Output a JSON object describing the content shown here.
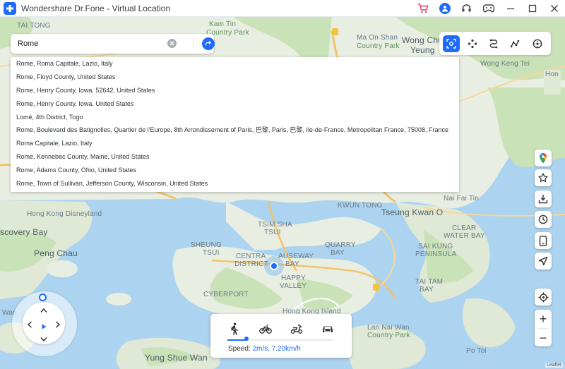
{
  "app": {
    "title": "Wondershare Dr.Fone - Virtual Location",
    "accent": "#1f6bff"
  },
  "titlebar_icons": [
    "cart-icon",
    "user-icon",
    "headset-icon",
    "gamepad-icon",
    "minimize-icon",
    "maximize-icon",
    "close-icon"
  ],
  "search": {
    "value": "Rome",
    "clear_icon": "clear-icon",
    "go_icon": "go-arrow-icon"
  },
  "results": [
    "Rome, Roma Capitale, Lazio, Italy",
    "Rome, Floyd County, United States",
    "Rome, Henry County, Iowa, 52642, United States",
    "Rome, Henry County, Iowa, United States",
    "Lomé, 4th District, Togo",
    "Rome, Boulevard des Batignolles, Quartier de l'Europe, 8th Arrondissement of Paris, 巴黎, Paris, 巴黎, Ile-de-France, Metropolitan France, 75008, France",
    "Roma Capitale, Lazio, Italy",
    "Rome, Kennebec County, Maine, United States",
    "Rome, Adams County, Ohio, United States",
    "Rome, Town of Sullivan, Jefferson County, Wisconsin, United States"
  ],
  "mode_toolbar": {
    "active_index": 0,
    "icons": [
      "teleport-mode-icon",
      "jump-teleport-icon",
      "one-stop-route-icon",
      "multi-stop-route-icon",
      "joystick-mode-icon"
    ]
  },
  "side_buttons": [
    "google-maps-icon",
    "favorites-icon",
    "import-gpx-icon",
    "history-icon",
    "device-icon",
    "navigate-icon"
  ],
  "zoom": {
    "locate_icon": "locate-icon",
    "plus": "+",
    "minus": "−"
  },
  "map_labels": {
    "tai_tong": "TAI TONG",
    "kam_tin": "Kam Tin",
    "country_park": "Country Park",
    "ma_on_shan": "Ma On Shan",
    "ma_on_shan_park": "Country Park",
    "wong_chuk_yeung_1": "Wong Chu",
    "wong_chuk_yeung_2": "Yeung",
    "wong_keng_tei": "Wong Keng Tei",
    "ping_chau": "Peng Chau",
    "discovery_bay": "scovery Bay",
    "hk_disneyland": "Hong Kong Disneyland",
    "tsim_sha_tsui_1": "TSIM SHA",
    "tsim_sha_tsui_2": "TSUI",
    "sheung_wan_1": "SHEUNG",
    "sheung_wan_2": "TSUI",
    "central_1": "CENTRA",
    "central_2": "DISTRICT",
    "causeway_1": "AUSEWAY",
    "causeway_2": "BAY",
    "quarry_1": "QUARRY",
    "quarry_2": "BAY",
    "happy_1": "HAPPY",
    "happy_2": "VALLEY",
    "cyberport": "CYBERPORT",
    "kwun_tong": "KWUN TONG",
    "tseung_kwan_o": "Tseung Kwan O",
    "clear_water_1": "CLEAR",
    "clear_water_2": "WATER BAY",
    "sai_kung_1": "SAI KUNG",
    "sai_kung_2": "PENINSULA",
    "tai_tam_1": "TAI TAM",
    "tai_tam_2": "BAY",
    "nai_fai_tin": "Nai Fai Tin",
    "hong_kong_island": "Hong Kong Island",
    "lan_nai_wan_1": "Lan Nai Wan",
    "lan_nai_wan_2": "Country Park",
    "yung_shue_wan": "Yung Shue Wan",
    "po_toi": "Po Toi",
    "south_lantau": "Wan",
    "big_wave": "Hon"
  },
  "speed": {
    "modes": [
      "walk-icon",
      "bike-icon",
      "scooter-icon",
      "car-icon"
    ],
    "active_index": 0,
    "level": 0.18,
    "label": "Speed:",
    "value": "2m/s, 7.20km/h"
  },
  "attribution": "Leaflet"
}
